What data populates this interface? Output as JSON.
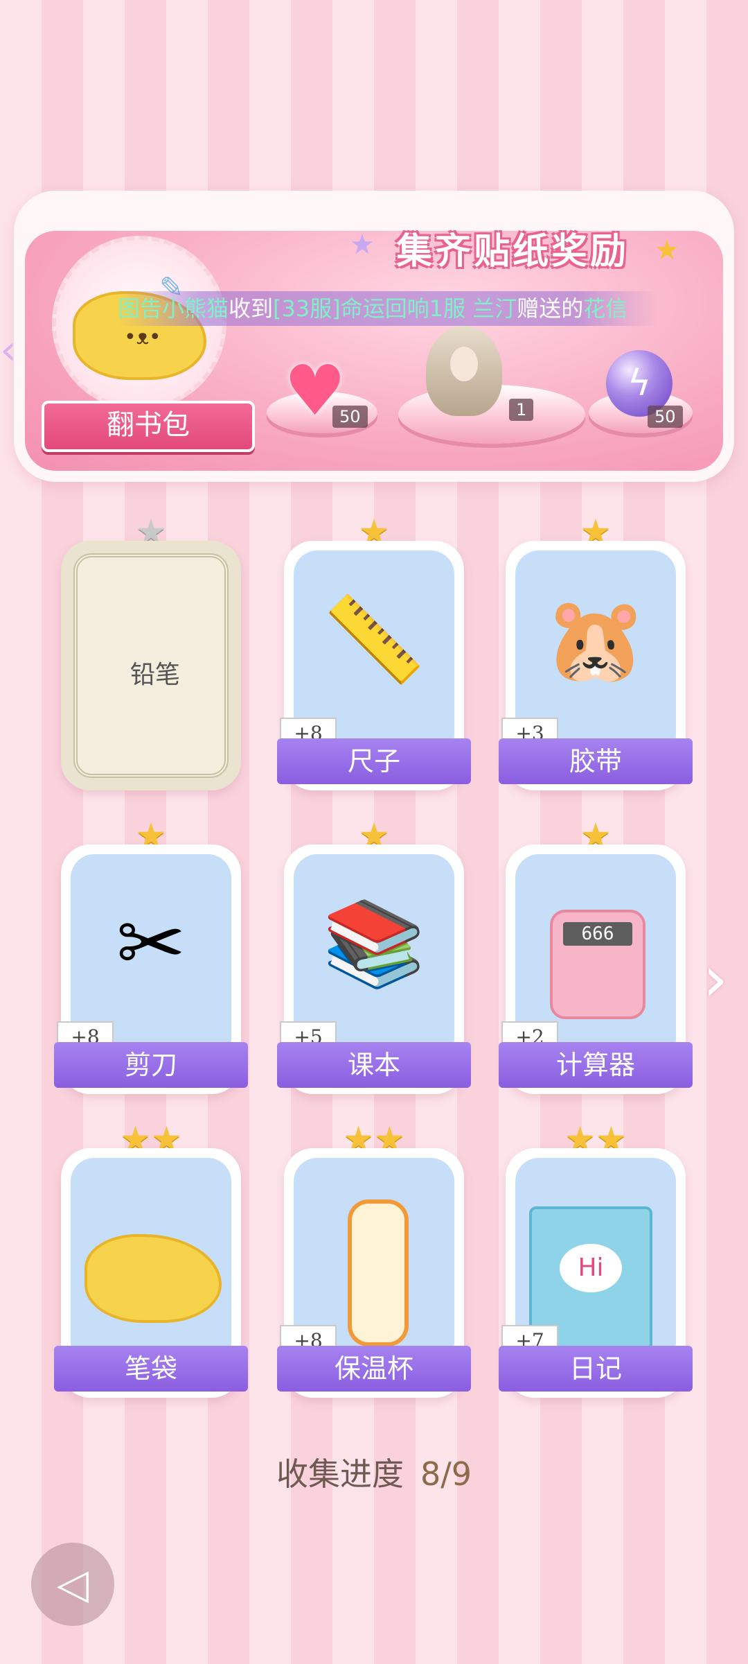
{
  "banner": {
    "title": "集齐贴纸奖励",
    "book_label": "翻书包",
    "marquee": {
      "name1": "图告小熊猫",
      "mid1": "收到",
      "item": "[33服]命运回响1服",
      "name2": "兰汀",
      "mid2": "赠送的",
      "gift": "花信"
    },
    "rewards": [
      {
        "icon": "pink-heart-gem-icon",
        "qty": "50"
      },
      {
        "icon": "costume-figure-icon",
        "qty": "1"
      },
      {
        "icon": "purple-energy-orb-icon",
        "qty": "50"
      }
    ]
  },
  "stickers": [
    {
      "name": "铅笔",
      "stars": "★",
      "locked": true,
      "plus": ""
    },
    {
      "name": "尺子",
      "stars": "★",
      "locked": false,
      "plus": "+8",
      "icon": "ruler-icon"
    },
    {
      "name": "胶带",
      "stars": "★",
      "locked": false,
      "plus": "+3",
      "icon": "tape-icon"
    },
    {
      "name": "剪刀",
      "stars": "★",
      "locked": false,
      "plus": "+8",
      "icon": "scissors-icon"
    },
    {
      "name": "课本",
      "stars": "★",
      "locked": false,
      "plus": "+5",
      "icon": "books-icon"
    },
    {
      "name": "计算器",
      "stars": "★",
      "locked": false,
      "plus": "+2",
      "icon": "calculator-icon"
    },
    {
      "name": "笔袋",
      "stars": "★★",
      "locked": false,
      "plus": "",
      "icon": "pencil-case-icon"
    },
    {
      "name": "保温杯",
      "stars": "★★",
      "locked": false,
      "plus": "+8",
      "icon": "thermos-icon"
    },
    {
      "name": "日记",
      "stars": "★★",
      "locked": false,
      "plus": "+7",
      "icon": "diary-icon"
    }
  ],
  "progress": {
    "label": "收集进度",
    "value": "8/9"
  },
  "calculator_display": "666",
  "diary_text": "Hi"
}
